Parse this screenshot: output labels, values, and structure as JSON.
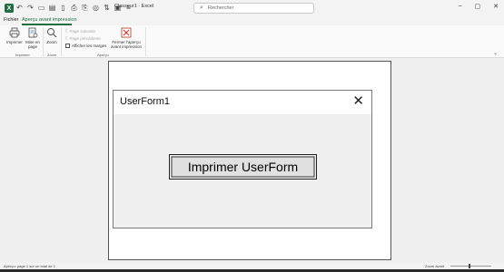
{
  "title_bar": {
    "app_icon": "excel-icon",
    "doc_title": "Classeur1 · Excel",
    "search_placeholder": "Rechercher",
    "window_controls": [
      "–",
      "▢",
      "✕"
    ]
  },
  "menu": {
    "tabs": [
      {
        "label": "Fichier",
        "active": false
      },
      {
        "label": "Aperçu avant impression",
        "active": true
      }
    ]
  },
  "ribbon": {
    "imprimer_group": {
      "label": "Imprimer",
      "buttons": [
        {
          "label": "Imprimer",
          "icon": "printer-icon"
        },
        {
          "label": "Mise en page",
          "icon": "page-setup-icon"
        }
      ]
    },
    "zoom_group": {
      "label": "Zoom",
      "buttons": [
        {
          "label": "Zoom",
          "icon": "magnifier-icon"
        }
      ]
    },
    "apercu_group": {
      "label": "Aperçu",
      "items": [
        {
          "label": "Page suivante",
          "enabled": false
        },
        {
          "label": "Page précédente",
          "enabled": false
        },
        {
          "label": "Afficher les marges",
          "enabled": true,
          "checked": false
        }
      ],
      "close_button": {
        "label": "Fermer l'aperçu avant impression",
        "icon": "close-preview-icon"
      }
    }
  },
  "preview": {
    "userform": {
      "title": "UserForm1",
      "button_label": "Imprimer UserForm"
    }
  },
  "status_bar": {
    "page_info": "Aperçu: page 1 sur un total de 1",
    "zoom_label": "Zoom avant"
  },
  "colors": {
    "accent": "#1d6f42",
    "close_red": "#c42b1c"
  }
}
